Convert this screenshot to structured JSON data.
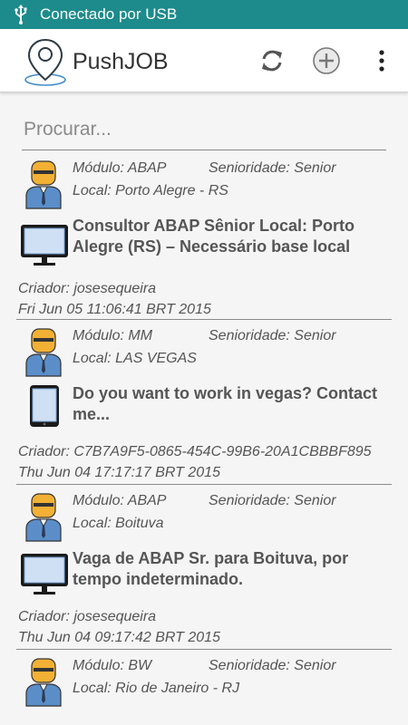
{
  "status": {
    "text": "Conectado por USB",
    "bg": "#1d8b8b"
  },
  "app": {
    "title": "PushJOB"
  },
  "actions": [
    {
      "icon": "refresh-icon"
    },
    {
      "icon": "add-circle-icon"
    },
    {
      "icon": "more-vert-icon"
    }
  ],
  "search": {
    "placeholder": "Procurar..."
  },
  "jobs": [
    {
      "modulo": "Módulo: ABAP",
      "senioridade": "Senioridade: Senior",
      "local": "Local: Porto Alegre - RS",
      "device": "desktop",
      "description": "Consultor ABAP Sênior Local: Porto Alegre (RS) – Necessário base local",
      "creator": "Criador: josesequeira",
      "date": "Fri Jun 05 11:06:41 BRT 2015"
    },
    {
      "modulo": "Módulo: MM",
      "senioridade": "Senioridade: Senior",
      "local": "Local: LAS VEGAS",
      "device": "tablet",
      "description": "Do you want to work in vegas? Contact me...",
      "creator": "Criador: C7B7A9F5-0865-454C-99B6-20A1CBBBF895",
      "date": "Thu Jun 04 17:17:17 BRT 2015"
    },
    {
      "modulo": "Módulo: ABAP",
      "senioridade": "Senioridade: Senior",
      "local": "Local: Boituva",
      "device": "desktop",
      "description": "Vaga de ABAP Sr. para Boituva, por tempo indeterminado.",
      "creator": "Criador: josesequeira",
      "date": "Thu Jun 04 09:17:42 BRT 2015"
    },
    {
      "modulo": "Módulo: BW",
      "senioridade": "Senioridade: Senior",
      "local": "Local: Rio de Janeiro - RJ"
    }
  ]
}
